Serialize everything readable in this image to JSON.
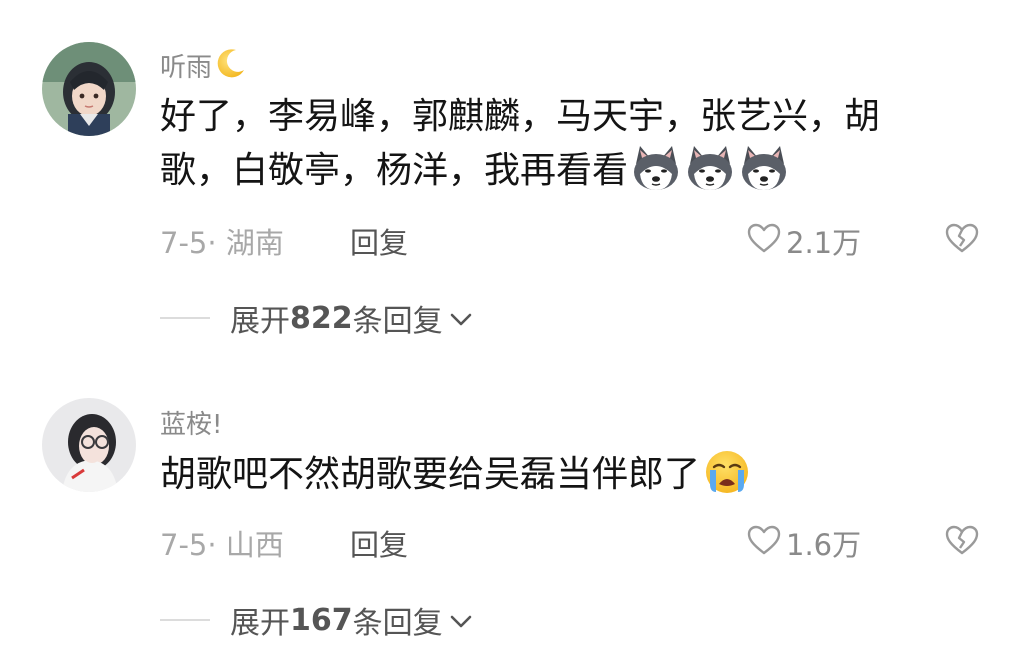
{
  "comments": [
    {
      "username": "听雨",
      "username_emoji": "crescent-moon-icon",
      "text_line1": "好了，李易峰，郭麒麟，马天宇，张艺兴，胡",
      "text_line2": "歌，白敬亭，杨洋，我再看看",
      "inline_emojis": [
        "husky-dog-emoji",
        "husky-dog-emoji",
        "husky-dog-emoji"
      ],
      "date": "7-5",
      "location": "湖南",
      "reply_label": "回复",
      "likes": "2.1万",
      "expand": {
        "prefix": "展开 ",
        "count": "822",
        "suffix": " 条回复"
      }
    },
    {
      "username": "蓝桉!",
      "text_line1": "胡歌吧不然胡歌要给吴磊当伴郎了",
      "inline_emojis": [
        "loudly-crying-face-emoji"
      ],
      "date": "7-5",
      "location": "山西",
      "reply_label": "回复",
      "likes": "1.6万",
      "expand": {
        "prefix": "展开 ",
        "count": "167",
        "suffix": " 条回复"
      }
    }
  ],
  "colors": {
    "username": "#8a8a8a",
    "content": "#141414",
    "meta": "#a8a8a8",
    "action": "#555555",
    "background": "#ffffff"
  }
}
